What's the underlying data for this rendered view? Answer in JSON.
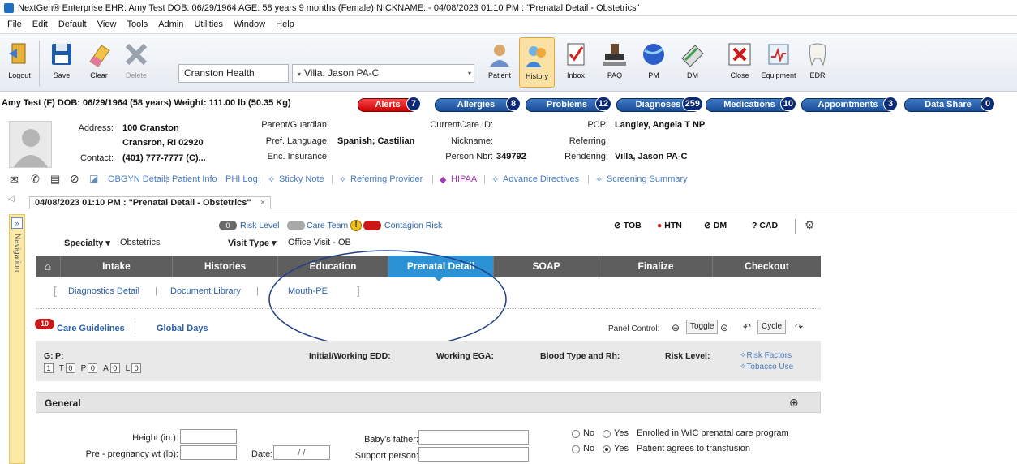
{
  "window": {
    "title": "NextGen® Enterprise EHR: Amy Test  DOB: 06/29/1964  AGE: 58 years 9 months  (Female)  NICKNAME:  - 04/08/2023 01:10 PM : \"Prenatal Detail - Obstetrics\""
  },
  "menu": [
    "File",
    "Edit",
    "Default",
    "View",
    "Tools",
    "Admin",
    "Utilities",
    "Window",
    "Help"
  ],
  "toolbar": {
    "logout": "Logout",
    "save": "Save",
    "clear": "Clear",
    "delete": "Delete",
    "location": "Cranston Health",
    "provider": "Villa, Jason PA-C",
    "patient": "Patient",
    "history": "History",
    "inbox": "Inbox",
    "paq": "PAQ",
    "pm": "PM",
    "dm": "DM",
    "close": "Close",
    "equipment": "Equipment",
    "edr": "EDR"
  },
  "patient": {
    "header": "Amy Test  (F)  DOB:  06/29/1964 (58 years)  Weight:  111.00 lb (50.35 Kg)",
    "badges": {
      "alerts": "Alerts",
      "alerts_count": "7",
      "allergies": "Allergies",
      "allergies_count": "8",
      "problems": "Problems",
      "problems_count": "12",
      "diagnoses": "Diagnoses",
      "diagnoses_count": "259",
      "medications": "Medications",
      "medications_count": "10",
      "appointments": "Appointments",
      "appointments_count": "3",
      "datashare": "Data Share",
      "datashare_count": "0"
    },
    "address_label": "Address:",
    "address1": "100 Cranston",
    "address2": "Cransron, RI 02920",
    "contact_label": "Contact:",
    "contact": "(401) 777-7777 (C)...",
    "guardian_label": "Parent/Guardian:",
    "language_label": "Pref. Language:",
    "language": "Spanish; Castilian",
    "insurance_label": "Enc. Insurance:",
    "currentcare_label": "CurrentCare ID:",
    "nickname_label": "Nickname:",
    "personnbr_label": "Person Nbr:",
    "personnbr": "349792",
    "pcp_label": "PCP:",
    "pcp": "Langley, Angela T NP",
    "referring_label": "Referring:",
    "rendering_label": "Rendering:",
    "rendering": "Villa, Jason PA-C"
  },
  "links": [
    "OBGYN Details",
    "Patient Info",
    "PHI Log",
    "Sticky Note",
    "Referring Provider",
    "HIPAA",
    "Advance Directives",
    "Screening Summary"
  ],
  "doc_tab": "04/08/2023 01:10 PM : \"Prenatal Detail - Obstetrics\"",
  "nav_label": "Navigation",
  "status": {
    "risk_count": "0",
    "risk_level": "Risk Level",
    "care_team": "Care Team",
    "contagion": "Contagion Risk",
    "tob": "TOB",
    "htn": "HTN",
    "dm": "DM",
    "cad": "CAD"
  },
  "specialty_label": "Specialty",
  "specialty": "Obstetrics",
  "visit_type_label": "Visit Type",
  "visit_type": "Office Visit - OB",
  "tabs": [
    "Intake",
    "Histories",
    "Education",
    "Prenatal Detail",
    "SOAP",
    "Finalize",
    "Checkout"
  ],
  "subtabs": [
    "Diagnostics Detail",
    "Document Library",
    "Mouth-PE"
  ],
  "care_guidelines_count": "10",
  "care_guidelines": "Care Guidelines",
  "global_days": "Global Days",
  "panel_control": {
    "label": "Panel Control:",
    "toggle": "Toggle",
    "cycle": "Cycle"
  },
  "obstat": {
    "g": "G:",
    "p": "P:",
    "g_val": "1",
    "t": "T",
    "t_val": "0",
    "p2": "P",
    "p_val": "0",
    "a": "A",
    "a_val": "0",
    "l": "L",
    "l_val": "0",
    "edd": "Initial/Working EDD:",
    "ega": "Working EGA:",
    "blood": "Blood Type and Rh:",
    "risk": "Risk Level:",
    "risk_factors": "Risk Factors",
    "tobacco": "Tobacco Use"
  },
  "general": {
    "title": "General",
    "height_label": "Height (in.):",
    "prewt_label": "Pre - pregnancy wt (lb):",
    "date_label": "Date:",
    "date_val": "/ /",
    "baby_father_label": "Baby's father:",
    "support_label": "Support person:",
    "no": "No",
    "yes": "Yes",
    "wic": "Enrolled in WIC prenatal care program",
    "transfusion": "Patient agrees to transfusion"
  }
}
